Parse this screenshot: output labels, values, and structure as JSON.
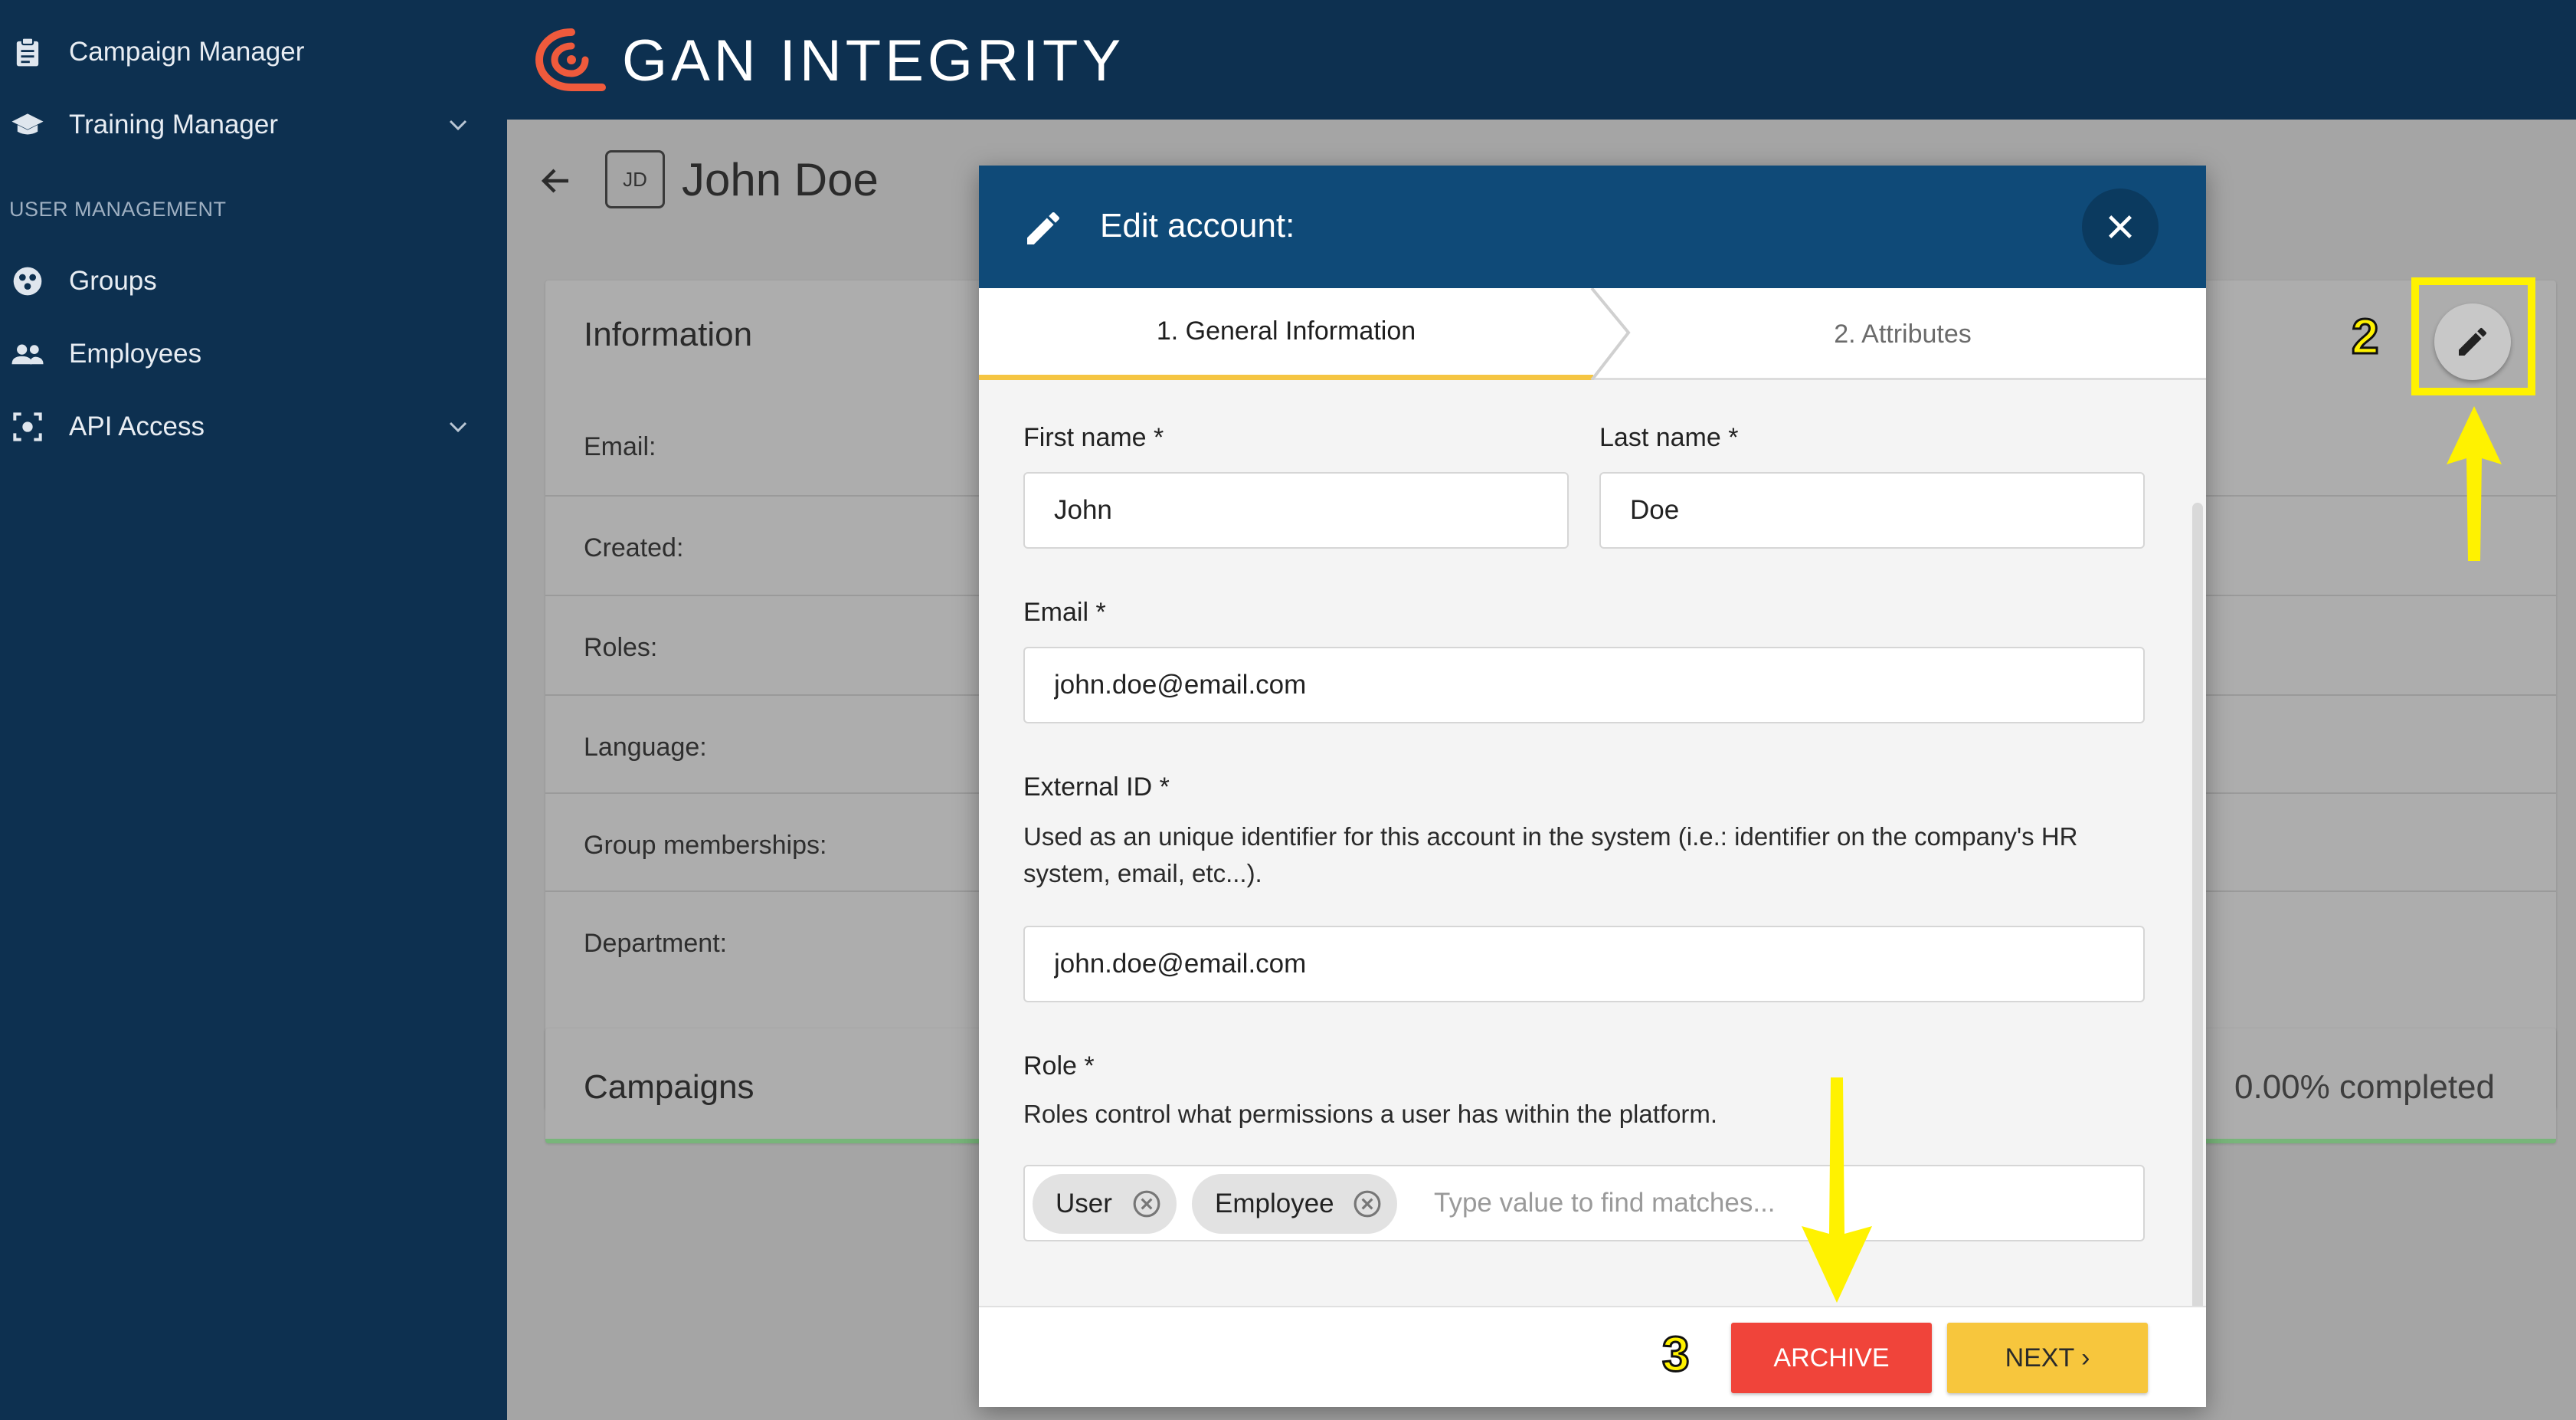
{
  "sidebar": {
    "items": [
      {
        "label": "Campaign Manager",
        "icon": "clipboard-icon"
      },
      {
        "label": "Training Manager",
        "icon": "graduation-cap-icon"
      },
      {
        "label": "Groups",
        "icon": "groups-icon"
      },
      {
        "label": "Employees",
        "icon": "employees-icon"
      },
      {
        "label": "API Access",
        "icon": "api-icon"
      }
    ],
    "section": "USER MANAGEMENT"
  },
  "header": {
    "brand": "GAN INTEGRITY"
  },
  "page": {
    "avatar": "JD",
    "title": "John Doe",
    "info_title": "Information",
    "info_rows": [
      "Email:",
      "Created:",
      "Roles:",
      "Language:",
      "Group memberships:",
      "Department:"
    ],
    "campaigns_title": "Campaigns",
    "completed": "0.00% completed"
  },
  "annotations": {
    "step2": "2",
    "step3": "3",
    "highlight_color": "#fff200"
  },
  "modal": {
    "title": "Edit account:",
    "tabs": [
      "1. General Information",
      "2. Attributes"
    ],
    "first_name": {
      "label": "First name *",
      "value": "John"
    },
    "last_name": {
      "label": "Last name *",
      "value": "Doe"
    },
    "email": {
      "label": "Email *",
      "value": "john.doe@email.com"
    },
    "external_id": {
      "label": "External ID *",
      "help": "Used as an unique identifier for this account in the system (i.e.: identifier on the company's HR system, email, etc...).",
      "value": "john.doe@email.com"
    },
    "role": {
      "label": "Role *",
      "help": "Roles control what permissions a user has within the platform.",
      "chips": [
        "User",
        "Employee"
      ],
      "placeholder": "Type value to find matches..."
    },
    "archive_label": "ARCHIVE",
    "next_label": "NEXT ›"
  },
  "colors": {
    "navy": "#0d3050",
    "modal_header": "#0f4a78",
    "accent_yellow": "#f5c542",
    "archive_red": "#f0443a",
    "brand_orange": "#ef5a3c"
  }
}
